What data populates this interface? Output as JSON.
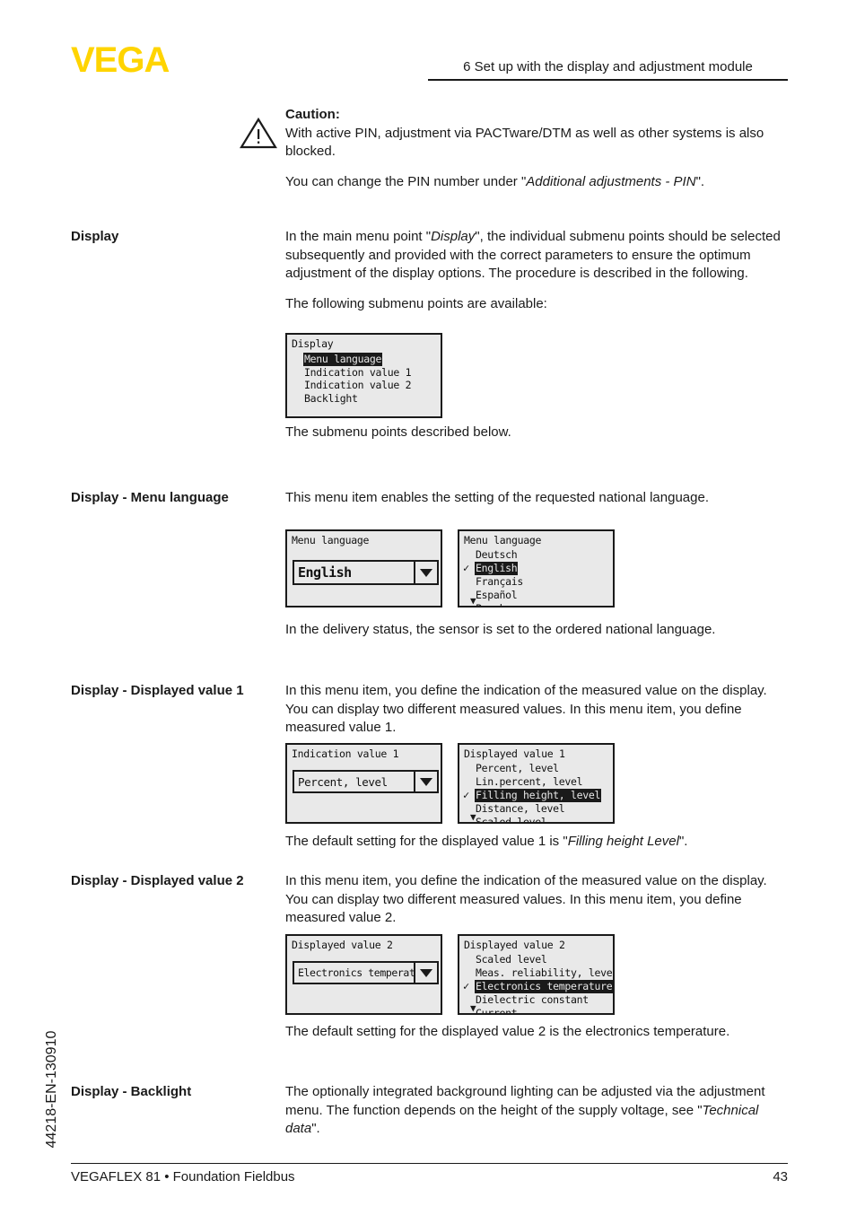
{
  "header": {
    "logo": "VEGA",
    "title": "6 Set up with the display and adjustment module"
  },
  "footer": {
    "left": "VEGAFLEX 81 • Foundation Fieldbus",
    "page": "43",
    "doc_number": "44218-EN-130910"
  },
  "caution": {
    "heading": "Caution:",
    "line1": "With active PIN, adjustment via PACTware/DTM as well as other systems is also blocked.",
    "line2_pre": "You can change the PIN number under \"",
    "line2_em": "Additional adjustments - PIN",
    "line2_post": "\"."
  },
  "sections": {
    "display": {
      "marginal": "Display",
      "p1_a": "In the main menu point \"",
      "p1_em": "Display",
      "p1_b": "\", the individual submenu points should be selected subsequently and provided with the correct parameters to ensure the optimum adjustment of the display options. The procedure is described in the following.",
      "p2": "The following submenu points are available:",
      "p3": "The submenu points described below.",
      "lcd": {
        "title": "Display",
        "items": [
          {
            "label": "Menu language",
            "selected": true
          },
          {
            "label": "Indication value 1",
            "selected": false
          },
          {
            "label": "Indication value 2",
            "selected": false
          },
          {
            "label": "Backlight",
            "selected": false
          }
        ]
      }
    },
    "menu_language": {
      "marginal": "Display - Menu language",
      "p1": "This menu item enables the setting of the requested national language.",
      "p2": "In the delivery status, the sensor is set to the ordered national language.",
      "lcd_left": {
        "title": "Menu language",
        "value": "English"
      },
      "lcd_right": {
        "title": "Menu language",
        "items": [
          {
            "label": "Deutsch",
            "selected": false,
            "check": false
          },
          {
            "label": "English",
            "selected": true,
            "check": true
          },
          {
            "label": "Français",
            "selected": false,
            "check": false
          },
          {
            "label": "Español",
            "selected": false,
            "check": false
          },
          {
            "label": "Pycckuu",
            "selected": false,
            "check": false
          }
        ],
        "more": "▼"
      }
    },
    "displayed_value_1": {
      "marginal": "Display - Displayed value 1",
      "p1": "In this menu item, you define the indication of the measured value on the display. You can display two different measured values. In this menu item, you define measured value 1.",
      "p2_pre": "The default setting for the displayed value 1 is \"",
      "p2_em": "Filling height Level",
      "p2_post": "\".",
      "lcd_left": {
        "title": "Indication value 1",
        "value": "Percent, level"
      },
      "lcd_right": {
        "title": "Displayed value 1",
        "items": [
          {
            "label": "Percent, level",
            "selected": false,
            "check": false
          },
          {
            "label": "Lin.percent, level",
            "selected": false,
            "check": false
          },
          {
            "label": "Filling height, level",
            "selected": true,
            "check": true
          },
          {
            "label": "Distance, level",
            "selected": false,
            "check": false
          },
          {
            "label": "Scaled level",
            "selected": false,
            "check": false
          }
        ],
        "more": "▼"
      }
    },
    "displayed_value_2": {
      "marginal": "Display - Displayed value 2",
      "p1": "In this menu item, you define the indication of the measured value on the display. You can display two different measured values. In this menu item, you define measured value 2.",
      "p2": "The default setting for the displayed value 2 is the electronics temperature.",
      "lcd_left": {
        "title": "Displayed value 2",
        "value": "Electronics temperature"
      },
      "lcd_right": {
        "title": "Displayed value 2",
        "items": [
          {
            "label": "Scaled level",
            "selected": false,
            "check": false
          },
          {
            "label": "Meas. reliability, level",
            "selected": false,
            "check": false
          },
          {
            "label": "Electronics temperature",
            "selected": true,
            "check": true
          },
          {
            "label": "Dielectric constant",
            "selected": false,
            "check": false
          },
          {
            "label": "Current",
            "selected": false,
            "check": false
          }
        ],
        "more": "▼"
      }
    },
    "backlight": {
      "marginal": "Display - Backlight",
      "p1_pre": "The optionally integrated background lighting can be adjusted via the adjustment menu. The function depends on the height of the supply voltage, see \"",
      "p1_em": "Technical data",
      "p1_post": "\"."
    }
  },
  "colors": {
    "brand_yellow": "#FFD400",
    "text": "#1a1a1a",
    "lcd_bg": "#e9e9e9"
  }
}
